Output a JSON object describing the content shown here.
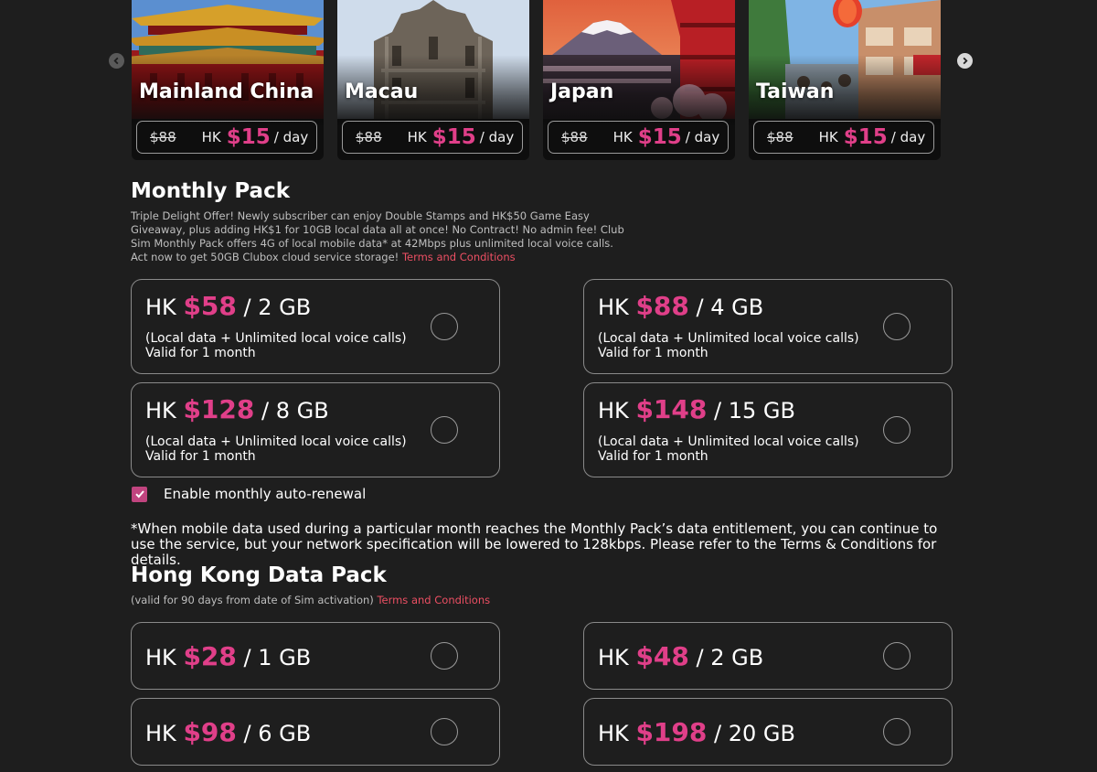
{
  "carousel": {
    "prev_icon": "chevron-left-icon",
    "next_icon": "chevron-right-icon",
    "cards": [
      {
        "name": "Mainland China",
        "old_price": "$88",
        "currency": "HK",
        "price": "$15",
        "unit": "/ day"
      },
      {
        "name": "Macau",
        "old_price": "$88",
        "currency": "HK",
        "price": "$15",
        "unit": "/ day"
      },
      {
        "name": "Japan",
        "old_price": "$88",
        "currency": "HK",
        "price": "$15",
        "unit": "/ day"
      },
      {
        "name": "Taiwan",
        "old_price": "$88",
        "currency": "HK",
        "price": "$15",
        "unit": "/ day"
      }
    ]
  },
  "monthly": {
    "title": "Monthly Pack",
    "description": "Triple Delight Offer! Newly subscriber can enjoy Double Stamps and HK$50 Game Easy Giveaway, plus adding HK$1 for 10GB local data all at once! No Contract! No admin fee! Club Sim Monthly Pack offers 4G of local mobile data* at 42Mbps plus unlimited local voice calls. Act now to get 50GB Clubox cloud service storage!",
    "tnc": "Terms and Conditions",
    "plans": [
      {
        "currency": "HK",
        "price": "$58",
        "size": "/ 2 GB",
        "detail": "(Local data + Unlimited local voice calls)",
        "validity": "Valid for 1 month"
      },
      {
        "currency": "HK",
        "price": "$88",
        "size": "/ 4 GB",
        "detail": "(Local data + Unlimited local voice calls)",
        "validity": "Valid for 1 month"
      },
      {
        "currency": "HK",
        "price": "$128",
        "size": "/ 8 GB",
        "detail": "(Local data + Unlimited local voice calls)",
        "validity": "Valid for 1 month"
      },
      {
        "currency": "HK",
        "price": "$148",
        "size": "/ 15 GB",
        "detail": "(Local data + Unlimited local voice calls)",
        "validity": "Valid for 1 month"
      }
    ],
    "auto_renew_label": "Enable monthly auto-renewal",
    "auto_renew_checked": true,
    "note": "*When mobile data used during a particular month reaches the Monthly Pack’s data entitlement, you can continue to use the service, but your network specification will be lowered to 128kbps. Please refer to the Terms & Conditions for details."
  },
  "hk_pack": {
    "title": "Hong Kong Data Pack",
    "description": "(valid for 90 days from date of Sim activation)",
    "tnc": "Terms and Conditions",
    "plans": [
      {
        "currency": "HK",
        "price": "$28",
        "size": "/ 1 GB"
      },
      {
        "currency": "HK",
        "price": "$48",
        "size": "/ 2 GB"
      },
      {
        "currency": "HK",
        "price": "$98",
        "size": "/ 6 GB"
      },
      {
        "currency": "HK",
        "price": "$198",
        "size": "/ 20 GB"
      }
    ]
  },
  "colors": {
    "accent": "#e03f89",
    "link": "#ec4f63",
    "background": "#1e1e1e",
    "checkbox": "#c1447f"
  }
}
